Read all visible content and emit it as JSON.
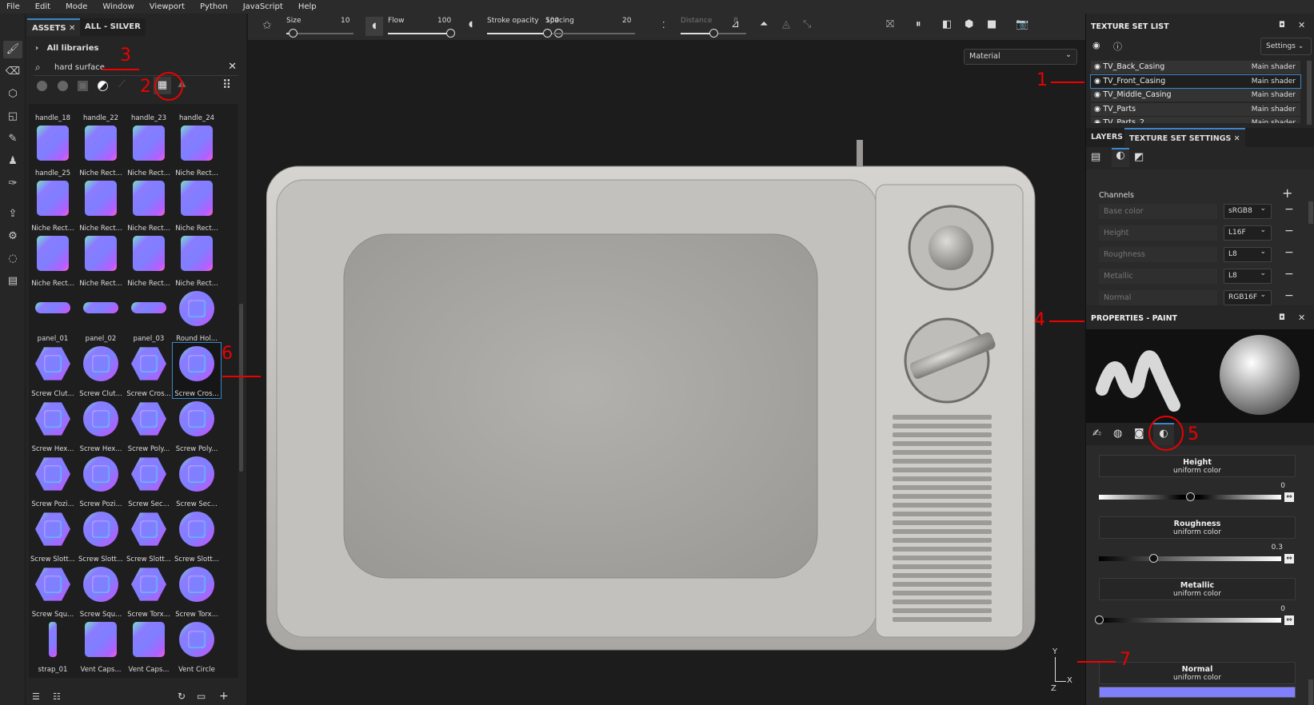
{
  "menu": [
    "File",
    "Edit",
    "Mode",
    "Window",
    "Viewport",
    "Python",
    "JavaScript",
    "Help"
  ],
  "assets": {
    "tabs": [
      "ASSETS",
      "ALL - SILVER"
    ],
    "breadcrumb": "All libraries",
    "search_value": "hard surface",
    "filter_icons": [
      "material-sphere-icon",
      "smart-material-icon",
      "mask-icon",
      "smart-mask-icon",
      "brush-icon",
      "texture-grid-icon",
      "environment-icon"
    ],
    "active_filter": "texture-grid-icon",
    "items": [
      {
        "label": "handle_18",
        "shape": "none"
      },
      {
        "label": "handle_22",
        "shape": "none"
      },
      {
        "label": "handle_23",
        "shape": "none"
      },
      {
        "label": "handle_24",
        "shape": "none"
      },
      {
        "label": "handle_25",
        "shape": "rect"
      },
      {
        "label": "Niche Rect...",
        "shape": "rect"
      },
      {
        "label": "Niche Rect...",
        "shape": "rect"
      },
      {
        "label": "Niche Rect...",
        "shape": "rect"
      },
      {
        "label": "Niche Rect...",
        "shape": "rect"
      },
      {
        "label": "Niche Rect...",
        "shape": "rect"
      },
      {
        "label": "Niche Rect...",
        "shape": "rect"
      },
      {
        "label": "Niche Rect...",
        "shape": "rect"
      },
      {
        "label": "Niche Rect...",
        "shape": "rect"
      },
      {
        "label": "Niche Rect...",
        "shape": "rect"
      },
      {
        "label": "Niche Rect...",
        "shape": "rect"
      },
      {
        "label": "Niche Rect...",
        "shape": "rect"
      },
      {
        "label": "panel_01",
        "shape": "pill"
      },
      {
        "label": "panel_02",
        "shape": "pill"
      },
      {
        "label": "panel_03",
        "shape": "pill"
      },
      {
        "label": "Round Hol...",
        "shape": "circle"
      },
      {
        "label": "Screw Clut...",
        "shape": "hex"
      },
      {
        "label": "Screw Clut...",
        "shape": "circle"
      },
      {
        "label": "Screw Cros...",
        "shape": "hex"
      },
      {
        "label": "Screw Cros...",
        "shape": "circle",
        "selected": true
      },
      {
        "label": "Screw Hex...",
        "shape": "hex"
      },
      {
        "label": "Screw Hex...",
        "shape": "circle"
      },
      {
        "label": "Screw Poly...",
        "shape": "hex"
      },
      {
        "label": "Screw Poly...",
        "shape": "circle"
      },
      {
        "label": "Screw Pozi...",
        "shape": "hex"
      },
      {
        "label": "Screw Pozi...",
        "shape": "circle"
      },
      {
        "label": "Screw Sec...",
        "shape": "hex"
      },
      {
        "label": "Screw Sec...",
        "shape": "circle"
      },
      {
        "label": "Screw Slott...",
        "shape": "hex"
      },
      {
        "label": "Screw Slott...",
        "shape": "circle"
      },
      {
        "label": "Screw Slott...",
        "shape": "hex"
      },
      {
        "label": "Screw Slott...",
        "shape": "circle"
      },
      {
        "label": "Screw Squ...",
        "shape": "hex"
      },
      {
        "label": "Screw Squ...",
        "shape": "circle"
      },
      {
        "label": "Screw Torx...",
        "shape": "hex"
      },
      {
        "label": "Screw Torx...",
        "shape": "circle"
      },
      {
        "label": "strap_01",
        "shape": "strap"
      },
      {
        "label": "Vent Caps...",
        "shape": "rect"
      },
      {
        "label": "Vent Caps...",
        "shape": "rect"
      },
      {
        "label": "Vent Circle",
        "shape": "circle"
      }
    ]
  },
  "toolbar": {
    "sliders": [
      {
        "label": "Size",
        "value": "10",
        "fraction": 0.1
      },
      {
        "label": "Flow",
        "value": "100",
        "fraction": 1
      },
      {
        "label": "Stroke opacity",
        "value": "100",
        "fraction": 1
      },
      {
        "label": "Spacing",
        "value": "20",
        "fraction": 0.02
      },
      {
        "label": "Distance",
        "value": "8",
        "fraction": 0.5
      }
    ]
  },
  "viewport": {
    "mode_dropdown": "Material",
    "axes": [
      "Y",
      "X",
      "Z"
    ]
  },
  "texture_set_list": {
    "title": "TEXTURE SET LIST",
    "settings_label": "Settings",
    "rows": [
      {
        "name": "TV_Back_Casing",
        "shader": "Main shader"
      },
      {
        "name": "TV_Front_Casing",
        "shader": "Main shader",
        "selected": true
      },
      {
        "name": "TV_Middle_Casing",
        "shader": "Main shader"
      },
      {
        "name": "TV_Parts",
        "shader": "Main shader"
      },
      {
        "name": "TV_Parts_2",
        "shader": "Main shader"
      }
    ]
  },
  "texture_set_settings": {
    "tabs": [
      "LAYERS",
      "TEXTURE SET SETTINGS"
    ],
    "channels_label": "Channels",
    "channels": [
      {
        "name": "Base color",
        "format": "sRGB8"
      },
      {
        "name": "Height",
        "format": "L16F"
      },
      {
        "name": "Roughness",
        "format": "L8"
      },
      {
        "name": "Metallic",
        "format": "L8"
      },
      {
        "name": "Normal",
        "format": "RGB16F"
      }
    ]
  },
  "properties": {
    "title": "PROPERTIES - PAINT",
    "materials": [
      {
        "name": "Height",
        "sub": "uniform color",
        "value": "0",
        "fraction": 0.5
      },
      {
        "name": "Roughness",
        "sub": "uniform color",
        "value": "0.3",
        "fraction": 0.3
      },
      {
        "name": "Metallic",
        "sub": "uniform color",
        "value": "0",
        "fraction": 0
      }
    ],
    "normal": {
      "name": "Normal",
      "sub": "uniform color",
      "color": "#8080ff"
    }
  },
  "annotations": [
    "1",
    "2",
    "3",
    "4",
    "5",
    "6",
    "7"
  ],
  "colors": {
    "accent": "#3a86c8",
    "annotation": "#e00000",
    "normal": "#8080ff"
  }
}
